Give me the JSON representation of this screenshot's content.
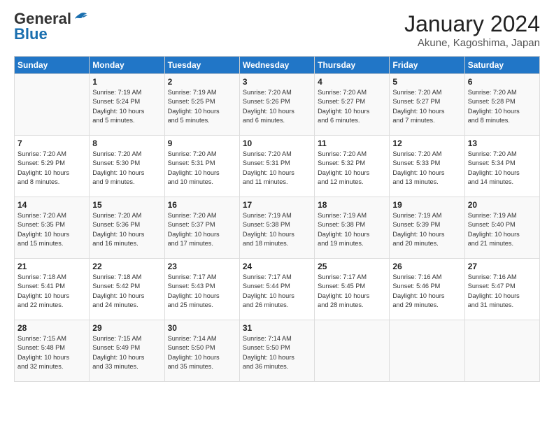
{
  "header": {
    "logo_line1": "General",
    "logo_line2": "Blue",
    "month": "January 2024",
    "location": "Akune, Kagoshima, Japan"
  },
  "weekdays": [
    "Sunday",
    "Monday",
    "Tuesday",
    "Wednesday",
    "Thursday",
    "Friday",
    "Saturday"
  ],
  "weeks": [
    [
      {
        "day": "",
        "info": ""
      },
      {
        "day": "1",
        "info": "Sunrise: 7:19 AM\nSunset: 5:24 PM\nDaylight: 10 hours\nand 5 minutes."
      },
      {
        "day": "2",
        "info": "Sunrise: 7:19 AM\nSunset: 5:25 PM\nDaylight: 10 hours\nand 5 minutes."
      },
      {
        "day": "3",
        "info": "Sunrise: 7:20 AM\nSunset: 5:26 PM\nDaylight: 10 hours\nand 6 minutes."
      },
      {
        "day": "4",
        "info": "Sunrise: 7:20 AM\nSunset: 5:27 PM\nDaylight: 10 hours\nand 6 minutes."
      },
      {
        "day": "5",
        "info": "Sunrise: 7:20 AM\nSunset: 5:27 PM\nDaylight: 10 hours\nand 7 minutes."
      },
      {
        "day": "6",
        "info": "Sunrise: 7:20 AM\nSunset: 5:28 PM\nDaylight: 10 hours\nand 8 minutes."
      }
    ],
    [
      {
        "day": "7",
        "info": "Sunrise: 7:20 AM\nSunset: 5:29 PM\nDaylight: 10 hours\nand 8 minutes."
      },
      {
        "day": "8",
        "info": "Sunrise: 7:20 AM\nSunset: 5:30 PM\nDaylight: 10 hours\nand 9 minutes."
      },
      {
        "day": "9",
        "info": "Sunrise: 7:20 AM\nSunset: 5:31 PM\nDaylight: 10 hours\nand 10 minutes."
      },
      {
        "day": "10",
        "info": "Sunrise: 7:20 AM\nSunset: 5:31 PM\nDaylight: 10 hours\nand 11 minutes."
      },
      {
        "day": "11",
        "info": "Sunrise: 7:20 AM\nSunset: 5:32 PM\nDaylight: 10 hours\nand 12 minutes."
      },
      {
        "day": "12",
        "info": "Sunrise: 7:20 AM\nSunset: 5:33 PM\nDaylight: 10 hours\nand 13 minutes."
      },
      {
        "day": "13",
        "info": "Sunrise: 7:20 AM\nSunset: 5:34 PM\nDaylight: 10 hours\nand 14 minutes."
      }
    ],
    [
      {
        "day": "14",
        "info": "Sunrise: 7:20 AM\nSunset: 5:35 PM\nDaylight: 10 hours\nand 15 minutes."
      },
      {
        "day": "15",
        "info": "Sunrise: 7:20 AM\nSunset: 5:36 PM\nDaylight: 10 hours\nand 16 minutes."
      },
      {
        "day": "16",
        "info": "Sunrise: 7:20 AM\nSunset: 5:37 PM\nDaylight: 10 hours\nand 17 minutes."
      },
      {
        "day": "17",
        "info": "Sunrise: 7:19 AM\nSunset: 5:38 PM\nDaylight: 10 hours\nand 18 minutes."
      },
      {
        "day": "18",
        "info": "Sunrise: 7:19 AM\nSunset: 5:38 PM\nDaylight: 10 hours\nand 19 minutes."
      },
      {
        "day": "19",
        "info": "Sunrise: 7:19 AM\nSunset: 5:39 PM\nDaylight: 10 hours\nand 20 minutes."
      },
      {
        "day": "20",
        "info": "Sunrise: 7:19 AM\nSunset: 5:40 PM\nDaylight: 10 hours\nand 21 minutes."
      }
    ],
    [
      {
        "day": "21",
        "info": "Sunrise: 7:18 AM\nSunset: 5:41 PM\nDaylight: 10 hours\nand 22 minutes."
      },
      {
        "day": "22",
        "info": "Sunrise: 7:18 AM\nSunset: 5:42 PM\nDaylight: 10 hours\nand 24 minutes."
      },
      {
        "day": "23",
        "info": "Sunrise: 7:17 AM\nSunset: 5:43 PM\nDaylight: 10 hours\nand 25 minutes."
      },
      {
        "day": "24",
        "info": "Sunrise: 7:17 AM\nSunset: 5:44 PM\nDaylight: 10 hours\nand 26 minutes."
      },
      {
        "day": "25",
        "info": "Sunrise: 7:17 AM\nSunset: 5:45 PM\nDaylight: 10 hours\nand 28 minutes."
      },
      {
        "day": "26",
        "info": "Sunrise: 7:16 AM\nSunset: 5:46 PM\nDaylight: 10 hours\nand 29 minutes."
      },
      {
        "day": "27",
        "info": "Sunrise: 7:16 AM\nSunset: 5:47 PM\nDaylight: 10 hours\nand 31 minutes."
      }
    ],
    [
      {
        "day": "28",
        "info": "Sunrise: 7:15 AM\nSunset: 5:48 PM\nDaylight: 10 hours\nand 32 minutes."
      },
      {
        "day": "29",
        "info": "Sunrise: 7:15 AM\nSunset: 5:49 PM\nDaylight: 10 hours\nand 33 minutes."
      },
      {
        "day": "30",
        "info": "Sunrise: 7:14 AM\nSunset: 5:50 PM\nDaylight: 10 hours\nand 35 minutes."
      },
      {
        "day": "31",
        "info": "Sunrise: 7:14 AM\nSunset: 5:50 PM\nDaylight: 10 hours\nand 36 minutes."
      },
      {
        "day": "",
        "info": ""
      },
      {
        "day": "",
        "info": ""
      },
      {
        "day": "",
        "info": ""
      }
    ]
  ]
}
